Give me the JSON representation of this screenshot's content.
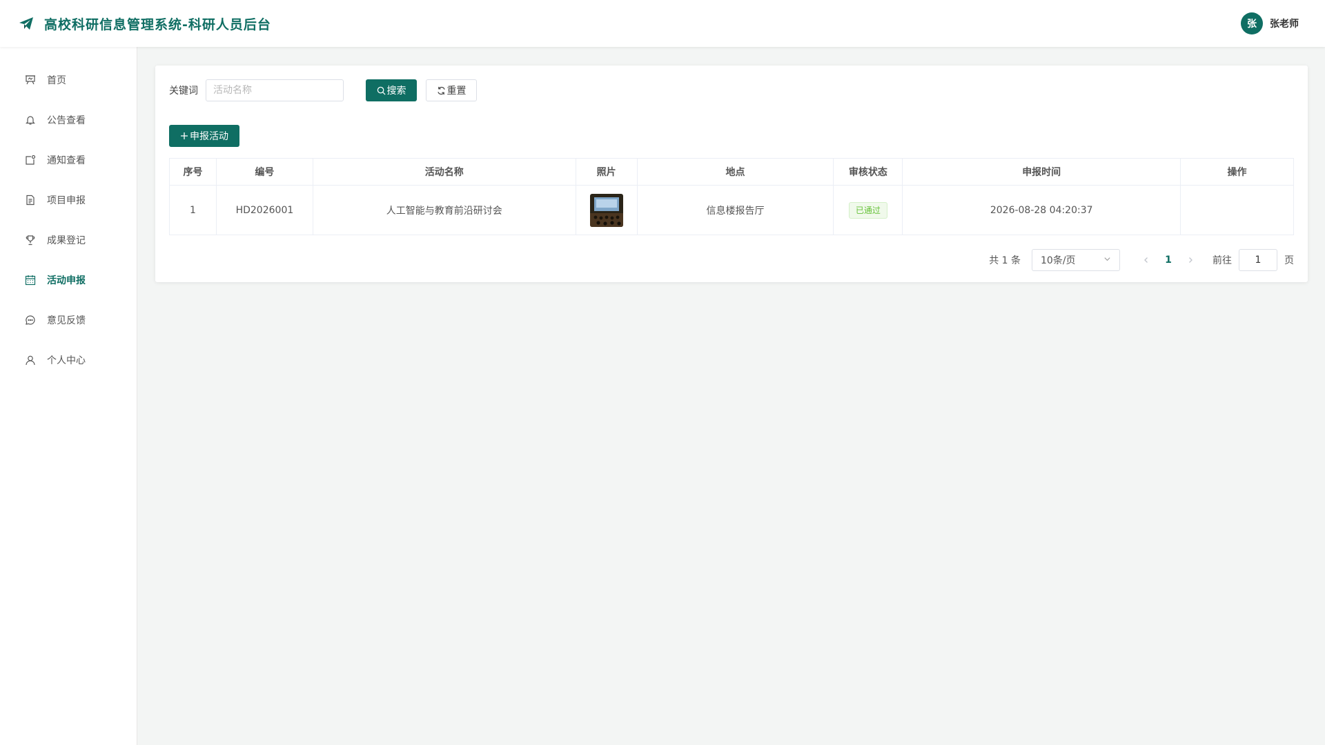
{
  "header": {
    "title": "高校科研信息管理系统-科研人员后台",
    "avatar_text": "张",
    "user_name": "张老师",
    "logo_icon": "paper-plane-icon"
  },
  "sidebar": {
    "items": [
      {
        "label": "首页",
        "icon": "presentation-icon"
      },
      {
        "label": "公告查看",
        "icon": "bell-icon"
      },
      {
        "label": "通知查看",
        "icon": "notification-icon"
      },
      {
        "label": "项目申报",
        "icon": "document-icon"
      },
      {
        "label": "成果登记",
        "icon": "trophy-icon"
      },
      {
        "label": "活动申报",
        "icon": "calendar-icon",
        "active": true
      },
      {
        "label": "意见反馈",
        "icon": "chat-icon"
      },
      {
        "label": "个人中心",
        "icon": "user-icon"
      }
    ]
  },
  "search": {
    "label": "关键词",
    "placeholder": "活动名称",
    "value": "",
    "search_label": "搜索",
    "reset_label": "重置"
  },
  "add_button_label": "申报活动",
  "table": {
    "headers": [
      "序号",
      "编号",
      "活动名称",
      "照片",
      "地点",
      "审核状态",
      "申报时间",
      "操作"
    ],
    "rows": [
      {
        "index": "1",
        "code": "HD2026001",
        "name": "人工智能与教育前沿研讨会",
        "photo": "conference-hall-photo",
        "location": "信息楼报告厅",
        "status": "已通过",
        "time": "2026-08-28 04:20:37",
        "actions": ""
      }
    ]
  },
  "pagination": {
    "total_text": "共 1 条",
    "page_size": "10条/页",
    "current_page": "1",
    "goto_label": "前往",
    "goto_value": "1",
    "page_unit": "页"
  },
  "colors": {
    "primary": "#0f6e63",
    "background": "#f3f5f4",
    "success": "#67c23a"
  }
}
